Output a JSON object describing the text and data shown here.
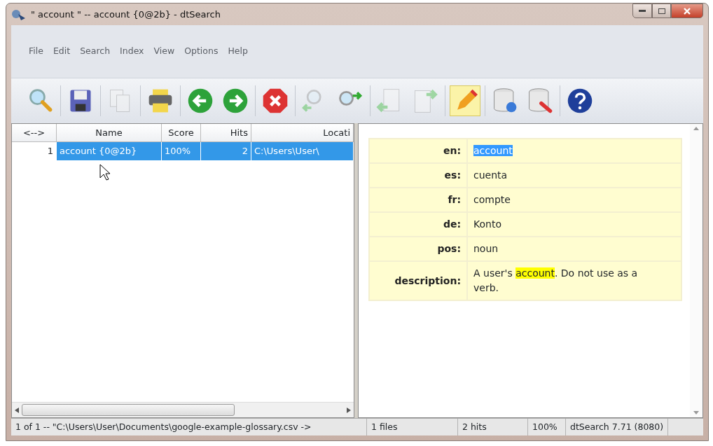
{
  "window": {
    "title": "\" account \" -- account {0@2b} - dtSearch"
  },
  "menu": [
    "File",
    "Edit",
    "Search",
    "Index",
    "View",
    "Options",
    "Help"
  ],
  "toolbar": [
    [
      {
        "kind": "search",
        "disabled": false
      }
    ],
    [
      {
        "kind": "save",
        "disabled": false
      }
    ],
    [
      {
        "kind": "copy",
        "disabled": true
      }
    ],
    [
      {
        "kind": "print",
        "disabled": false
      }
    ],
    [
      {
        "kind": "back",
        "disabled": false
      },
      {
        "kind": "forward",
        "disabled": false
      }
    ],
    [
      {
        "kind": "stop",
        "disabled": false
      }
    ],
    [
      {
        "kind": "prevhit",
        "disabled": true
      },
      {
        "kind": "nexthit",
        "disabled": false
      }
    ],
    [
      {
        "kind": "prevdoc",
        "disabled": true
      },
      {
        "kind": "nextdoc",
        "disabled": true
      }
    ],
    [
      {
        "kind": "edit",
        "disabled": false,
        "pressed": true
      }
    ],
    [
      {
        "kind": "indexupdate",
        "disabled": false
      },
      {
        "kind": "indexmanage",
        "disabled": false
      }
    ],
    [
      {
        "kind": "help",
        "disabled": false
      }
    ]
  ],
  "results": {
    "columns": [
      "<-->",
      "Name",
      "Score",
      "Hits",
      "Locati"
    ],
    "rows": [
      {
        "cells": [
          "1",
          "account {0@2b}",
          "100%",
          "2",
          "C:\\Users\\User\\"
        ],
        "selected": true
      }
    ]
  },
  "document": {
    "rows": [
      {
        "label": "en:",
        "value": [
          {
            "text": "account",
            "selected": true
          }
        ]
      },
      {
        "label": "es:",
        "value": [
          {
            "text": "cuenta"
          }
        ]
      },
      {
        "label": "fr:",
        "value": [
          {
            "text": "compte"
          }
        ]
      },
      {
        "label": "de:",
        "value": [
          {
            "text": "Konto"
          }
        ]
      },
      {
        "label": "pos:",
        "value": [
          {
            "text": "noun"
          }
        ]
      },
      {
        "label": "description:",
        "value": [
          {
            "text": "A user's "
          },
          {
            "text": "account",
            "hit": true
          },
          {
            "text": ". Do not use as a verb."
          }
        ]
      }
    ]
  },
  "status_bar": [
    "1 of 1 -- \"C:\\Users\\User\\Documents\\google-example-glossary.csv ->",
    "1 files",
    "2 hits",
    "100%",
    "dtSearch 7.71 (8080)"
  ]
}
